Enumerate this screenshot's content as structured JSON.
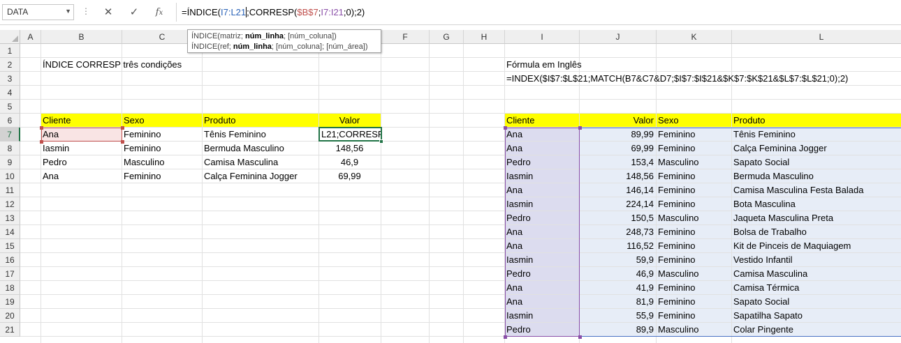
{
  "formula_bar": {
    "name_box": "DATA",
    "cancel_icon": "close-icon",
    "enter_icon": "check-icon",
    "function_icon": "fx-icon",
    "formula_parts": [
      "=ÍNDICE(",
      "I7:L21",
      ";",
      "CORRESP(",
      "$B$7",
      ";",
      "I7:I21",
      ";0);2)"
    ]
  },
  "tooltip": {
    "line1_a": "ÍNDICE(matriz; ",
    "line1_b": "núm_linha",
    "line1_c": "; [núm_coluna])",
    "line2_a": "ÍNDICE(ref; ",
    "line2_b": "núm_linha",
    "line2_c": "; [núm_coluna]; [núm_área])"
  },
  "columns": [
    "A",
    "B",
    "C",
    "D",
    "E",
    "F",
    "G",
    "H",
    "I",
    "J",
    "K",
    "L"
  ],
  "rows": [
    "1",
    "2",
    "3",
    "4",
    "5",
    "6",
    "7",
    "8",
    "9",
    "10",
    "11",
    "12",
    "13",
    "14",
    "15",
    "16",
    "17",
    "18",
    "19",
    "20",
    "21"
  ],
  "texts": {
    "title": "ÍNDICE CORRESP três condições",
    "formula_label": "Fórmula em Inglês",
    "formula_english": "=INDEX($I$7:$L$21;MATCH(B7&C7&D7;$I$7:$I$21&$K$7:$K$21&$L$7:$L$21;0);2)"
  },
  "left_table": {
    "headers": [
      "Cliente",
      "Sexo",
      "Produto",
      "Valor"
    ],
    "rows": [
      [
        "Ana",
        "Feminino",
        "Tênis Feminino",
        "L21;CORRESP("
      ],
      [
        "Iasmin",
        "Feminino",
        "Bermuda Masculino",
        "148,56"
      ],
      [
        "Pedro",
        "Masculino",
        "Camisa Masculina",
        "46,9"
      ],
      [
        "Ana",
        "Feminino",
        "Calça Feminina Jogger",
        "69,99"
      ]
    ]
  },
  "right_table": {
    "headers": [
      "Cliente",
      "Valor",
      "Sexo",
      "Produto"
    ],
    "rows": [
      [
        "Ana",
        "89,99",
        "Feminino",
        "Tênis Feminino"
      ],
      [
        "Ana",
        "69,99",
        "Feminino",
        "Calça Feminina Jogger"
      ],
      [
        "Pedro",
        "153,4",
        "Masculino",
        "Sapato Social"
      ],
      [
        "Iasmin",
        "148,56",
        "Feminino",
        "Bermuda Masculino"
      ],
      [
        "Ana",
        "146,14",
        "Feminino",
        "Camisa Masculina Festa Balada"
      ],
      [
        "Iasmin",
        "224,14",
        "Feminino",
        "Bota Masculina"
      ],
      [
        "Pedro",
        "150,5",
        "Masculino",
        "Jaqueta Masculina Preta"
      ],
      [
        "Ana",
        "248,73",
        "Feminino",
        "Bolsa de Trabalho"
      ],
      [
        "Ana",
        "116,52",
        "Feminino",
        "Kit de Pinceis de Maquiagem"
      ],
      [
        "Iasmin",
        "59,9",
        "Feminino",
        "Vestido Infantil"
      ],
      [
        "Pedro",
        "46,9",
        "Masculino",
        "Camisa Masculina"
      ],
      [
        "Ana",
        "41,9",
        "Feminino",
        "Camisa Térmica"
      ],
      [
        "Ana",
        "81,9",
        "Feminino",
        "Sapato Social"
      ],
      [
        "Iasmin",
        "55,9",
        "Feminino",
        "Sapatilha Sapato"
      ],
      [
        "Pedro",
        "89,9",
        "Masculino",
        "Colar Pingente"
      ]
    ]
  },
  "colors": {
    "header_fill": "#ffff00",
    "range_blue": "#4a72c4",
    "range_purple": "#8a4fa8",
    "range_red": "#c0504d",
    "active_green": "#217346"
  }
}
